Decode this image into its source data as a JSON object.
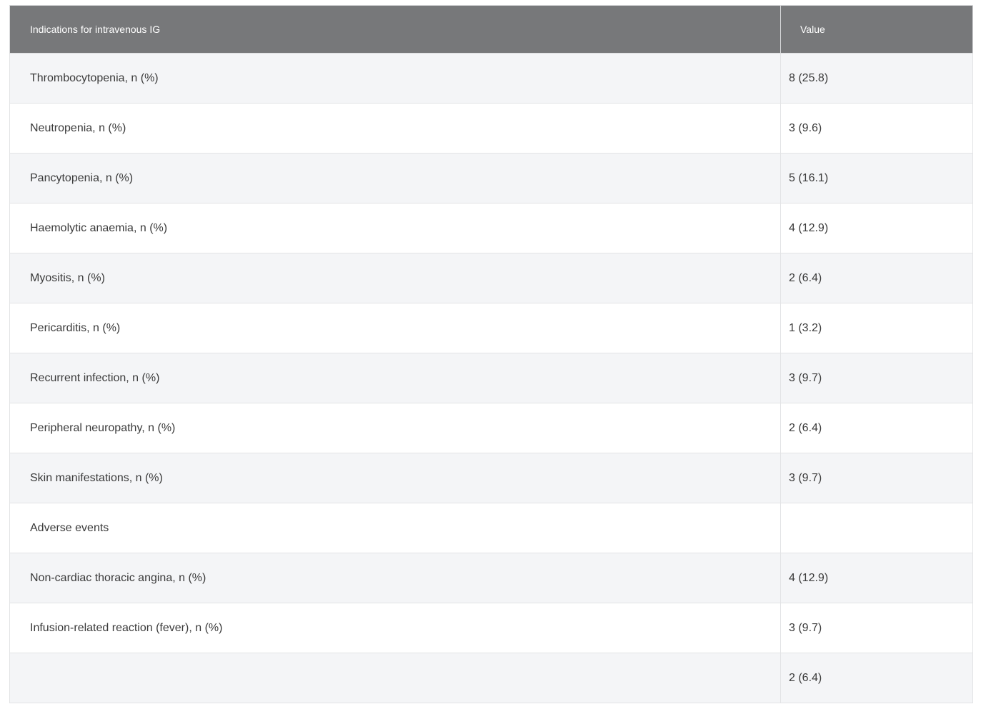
{
  "table": {
    "headers": [
      "Indications for intravenous IG",
      "Value"
    ],
    "rows": [
      {
        "label": "Thrombocytopenia, n (%)",
        "value": "8 (25.8)"
      },
      {
        "label": "Neutropenia, n (%)",
        "value": "3 (9.6)"
      },
      {
        "label": "Pancytopenia, n (%)",
        "value": "5 (16.1)"
      },
      {
        "label": "Haemolytic anaemia, n (%)",
        "value": "4 (12.9)"
      },
      {
        "label": "Myositis, n (%)",
        "value": "2 (6.4)"
      },
      {
        "label": "Pericarditis, n (%)",
        "value": "1 (3.2)"
      },
      {
        "label": "Recurrent infection, n (%)",
        "value": "3 (9.7)"
      },
      {
        "label": "Peripheral neuropathy, n (%)",
        "value": "2 (6.4)"
      },
      {
        "label": "Skin manifestations, n (%)",
        "value": "3 (9.7)"
      },
      {
        "label": "Adverse events",
        "value": ""
      },
      {
        "label": "Non-cardiac thoracic angina, n (%)",
        "value": "4 (12.9)"
      },
      {
        "label": "Infusion-related reaction (fever), n (%)",
        "value": "3 (9.7)"
      },
      {
        "label": "",
        "value": "2 (6.4)"
      }
    ]
  }
}
